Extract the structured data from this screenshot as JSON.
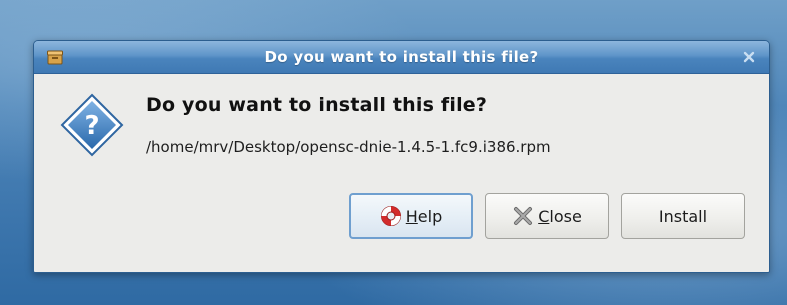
{
  "window": {
    "title": "Do you want to install this file?"
  },
  "dialog": {
    "heading": "Do you want to install this file?",
    "file_path": "/home/mrv/Desktop/opensc-dnie-1.4.5-1.fc9.i386.rpm"
  },
  "buttons": {
    "help": {
      "mnemonic": "H",
      "rest": "elp"
    },
    "close": {
      "mnemonic": "C",
      "rest": "lose"
    },
    "install": {
      "label": "Install"
    }
  },
  "icons": {
    "title": "package-icon",
    "window_close": "close-icon",
    "dialog": "question-icon",
    "help": "lifebuoy-icon",
    "close": "x-icon"
  },
  "colors": {
    "titlebar": "#4a84bd",
    "dialog_bg": "#ececea",
    "question_blue": "#3b7fc3"
  }
}
